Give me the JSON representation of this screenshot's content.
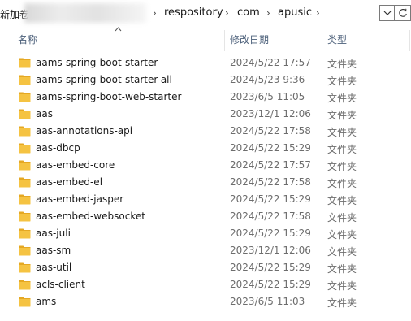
{
  "address_bar": {
    "prefix_text": "新加卷",
    "crumbs": [
      "respository",
      "com",
      "apusic"
    ],
    "separator": "›",
    "dropdown_icon": "chevron-down-icon",
    "refresh_icon": "refresh-icon"
  },
  "columns": {
    "name": "名称",
    "modified": "修改日期",
    "type": "类型"
  },
  "files": [
    {
      "name": "aams-spring-boot-starter",
      "modified": "2024/5/22 17:57",
      "type": "文件夹"
    },
    {
      "name": "aams-spring-boot-starter-all",
      "modified": "2024/5/23 9:36",
      "type": "文件夹"
    },
    {
      "name": "aams-spring-boot-web-starter",
      "modified": "2023/6/5 11:05",
      "type": "文件夹"
    },
    {
      "name": "aas",
      "modified": "2023/12/1 12:06",
      "type": "文件夹"
    },
    {
      "name": "aas-annotations-api",
      "modified": "2024/5/22 17:58",
      "type": "文件夹"
    },
    {
      "name": "aas-dbcp",
      "modified": "2024/5/22 15:29",
      "type": "文件夹"
    },
    {
      "name": "aas-embed-core",
      "modified": "2024/5/22 17:57",
      "type": "文件夹"
    },
    {
      "name": "aas-embed-el",
      "modified": "2024/5/22 17:58",
      "type": "文件夹"
    },
    {
      "name": "aas-embed-jasper",
      "modified": "2024/5/22 15:29",
      "type": "文件夹"
    },
    {
      "name": "aas-embed-websocket",
      "modified": "2024/5/22 17:58",
      "type": "文件夹"
    },
    {
      "name": "aas-juli",
      "modified": "2024/5/22 15:29",
      "type": "文件夹"
    },
    {
      "name": "aas-sm",
      "modified": "2023/12/1 12:06",
      "type": "文件夹"
    },
    {
      "name": "aas-util",
      "modified": "2024/5/22 15:29",
      "type": "文件夹"
    },
    {
      "name": "acls-client",
      "modified": "2024/5/22 15:29",
      "type": "文件夹"
    },
    {
      "name": "ams",
      "modified": "2023/6/5 11:03",
      "type": "文件夹"
    }
  ],
  "colors": {
    "folder": "#f5c342",
    "folder_tab": "#e5a823",
    "header_text": "#4c607a"
  }
}
